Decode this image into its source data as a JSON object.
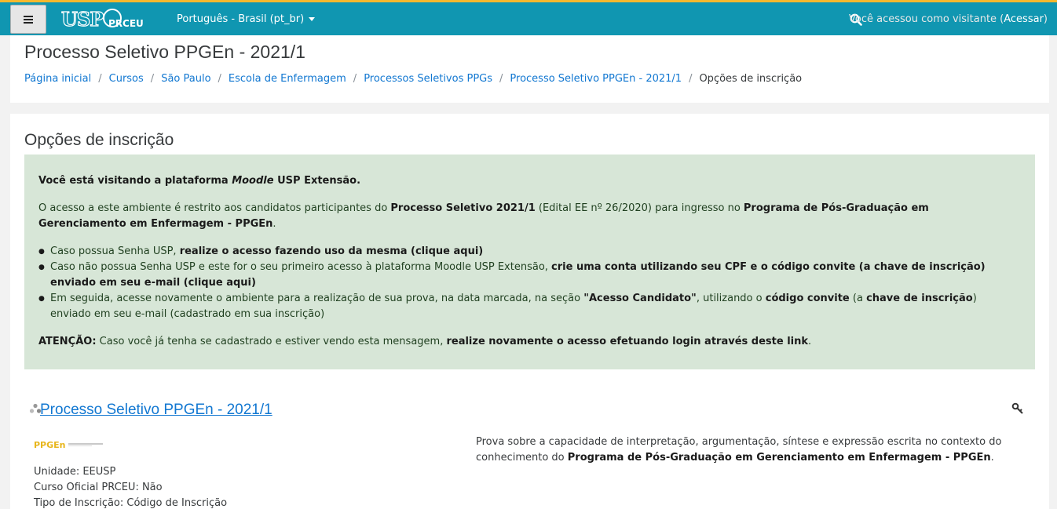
{
  "navbar": {
    "logo_text": "USP PRCEU",
    "language": "Português - Brasil (pt_br)",
    "login_prefix": "Você acessou como visitante (",
    "login_link": "Acessar",
    "login_suffix": ")"
  },
  "header": {
    "title": "Processo Seletivo PPGEn - 2021/1",
    "breadcrumb": [
      "Página inicial",
      "Cursos",
      "São Paulo",
      "Escola de Enfermagem",
      "Processos Seletivos PPGs",
      "Processo Seletivo PPGEn - 2021/1"
    ],
    "breadcrumb_current": "Opções de inscrição"
  },
  "main": {
    "section_title": "Opções de inscrição",
    "notice": {
      "l1_a": "Você está visitando a plataforma ",
      "l1_b": "Moodle",
      "l1_c": " USP Extensão.",
      "p2_a": "O acesso a este ambiente é restrito aos candidatos participantes do ",
      "p2_b": "Processo Seletivo 2021/1",
      "p2_c": " (Edital EE nº 26/2020) para ingresso no ",
      "p2_d": "Programa de Pós-Graduação em Gerenciamento em Enfermagem - PPGEn",
      "p2_e": ".",
      "b1_a": "Caso possua Senha USP, ",
      "b1_b": "realize o acesso fazendo uso da mesma (clique aqui)",
      "b2_a": "Caso não possua Senha USP e este for o seu primeiro acesso à plataforma Moodle USP Extensão, ",
      "b2_b": "crie uma conta utilizando seu CPF e o código convite (a chave de inscrição) enviado em seu e-mail (clique aqui)",
      "b3_a": "Em seguida, acesse novamente o ambiente para a realização de sua prova, na data marcada, na seção ",
      "b3_b": "\"Acesso Candidato\"",
      "b3_c": ", utilizando o ",
      "b3_d": "código convite",
      "b3_e": " (a ",
      "b3_f": "chave de inscrição",
      "b3_g": ") enviado em seu e-mail (cadastrado em sua inscrição)",
      "p4_a": "ATENÇÃO:",
      "p4_b": " Caso você já tenha se cadastrado e estiver vendo esta mensagem, ",
      "p4_c": "realize novamente o acesso efetuando login através deste link",
      "p4_d": "."
    },
    "course": {
      "name": "Processo Seletivo PPGEn - 2021/1",
      "logo_text": "PPGEn",
      "unidade": "Unidade: EEUSP",
      "oficial": "Curso Oficial PRCEU: Não",
      "tipo": "Tipo de Inscrição: Código de Inscrição",
      "summary_a": "Prova sobre a capacidade de interpretação, argumentação, síntese e expressão escrita no contexto do conhecimento do ",
      "summary_b": "Programa de Pós-Graduação em Gerenciamento em Enfermagem - PPGEn",
      "summary_c": "."
    }
  },
  "colors": {
    "navbar": "#1096b1",
    "navbar_top_border": "#f5b82e",
    "link": "#1177d1",
    "notice_bg": "#d7e6d7"
  },
  "icons": [
    "menu-icon",
    "search-icon",
    "course-icon",
    "key-icon"
  ]
}
